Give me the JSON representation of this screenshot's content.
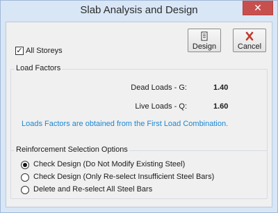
{
  "window": {
    "title": "Slab Analysis and Design",
    "close_glyph": "✕"
  },
  "toolbar": {
    "design_label": "Design",
    "design_icon": "document-icon",
    "cancel_label": "Cancel",
    "cancel_icon": "red-x-icon",
    "cancel_icon_color": "#c0392b"
  },
  "all_storeys": {
    "label": "All Storeys",
    "checked": true,
    "check_glyph": "✓"
  },
  "load_factors": {
    "title": "Load Factors",
    "dead_label": "Dead Loads - G:",
    "dead_value": "1.40",
    "live_label": "Live Loads - Q:",
    "live_value": "1.60",
    "note": "Loads Factors are obtained from the First Load Combination.",
    "note_color": "#1b87d1"
  },
  "reinforcement": {
    "title": "Reinforcement Selection Options",
    "options": [
      {
        "label": "Check Design (Do Not Modify Existing Steel)",
        "selected": true
      },
      {
        "label": "Check Design (Only Re-select Insufficient Steel Bars)",
        "selected": false
      },
      {
        "label": "Delete and Re-select All Steel Bars",
        "selected": false
      }
    ]
  },
  "colors": {
    "frame": "#d8e6f6",
    "client": "#f0f0f0",
    "close_button": "#c7504f"
  }
}
